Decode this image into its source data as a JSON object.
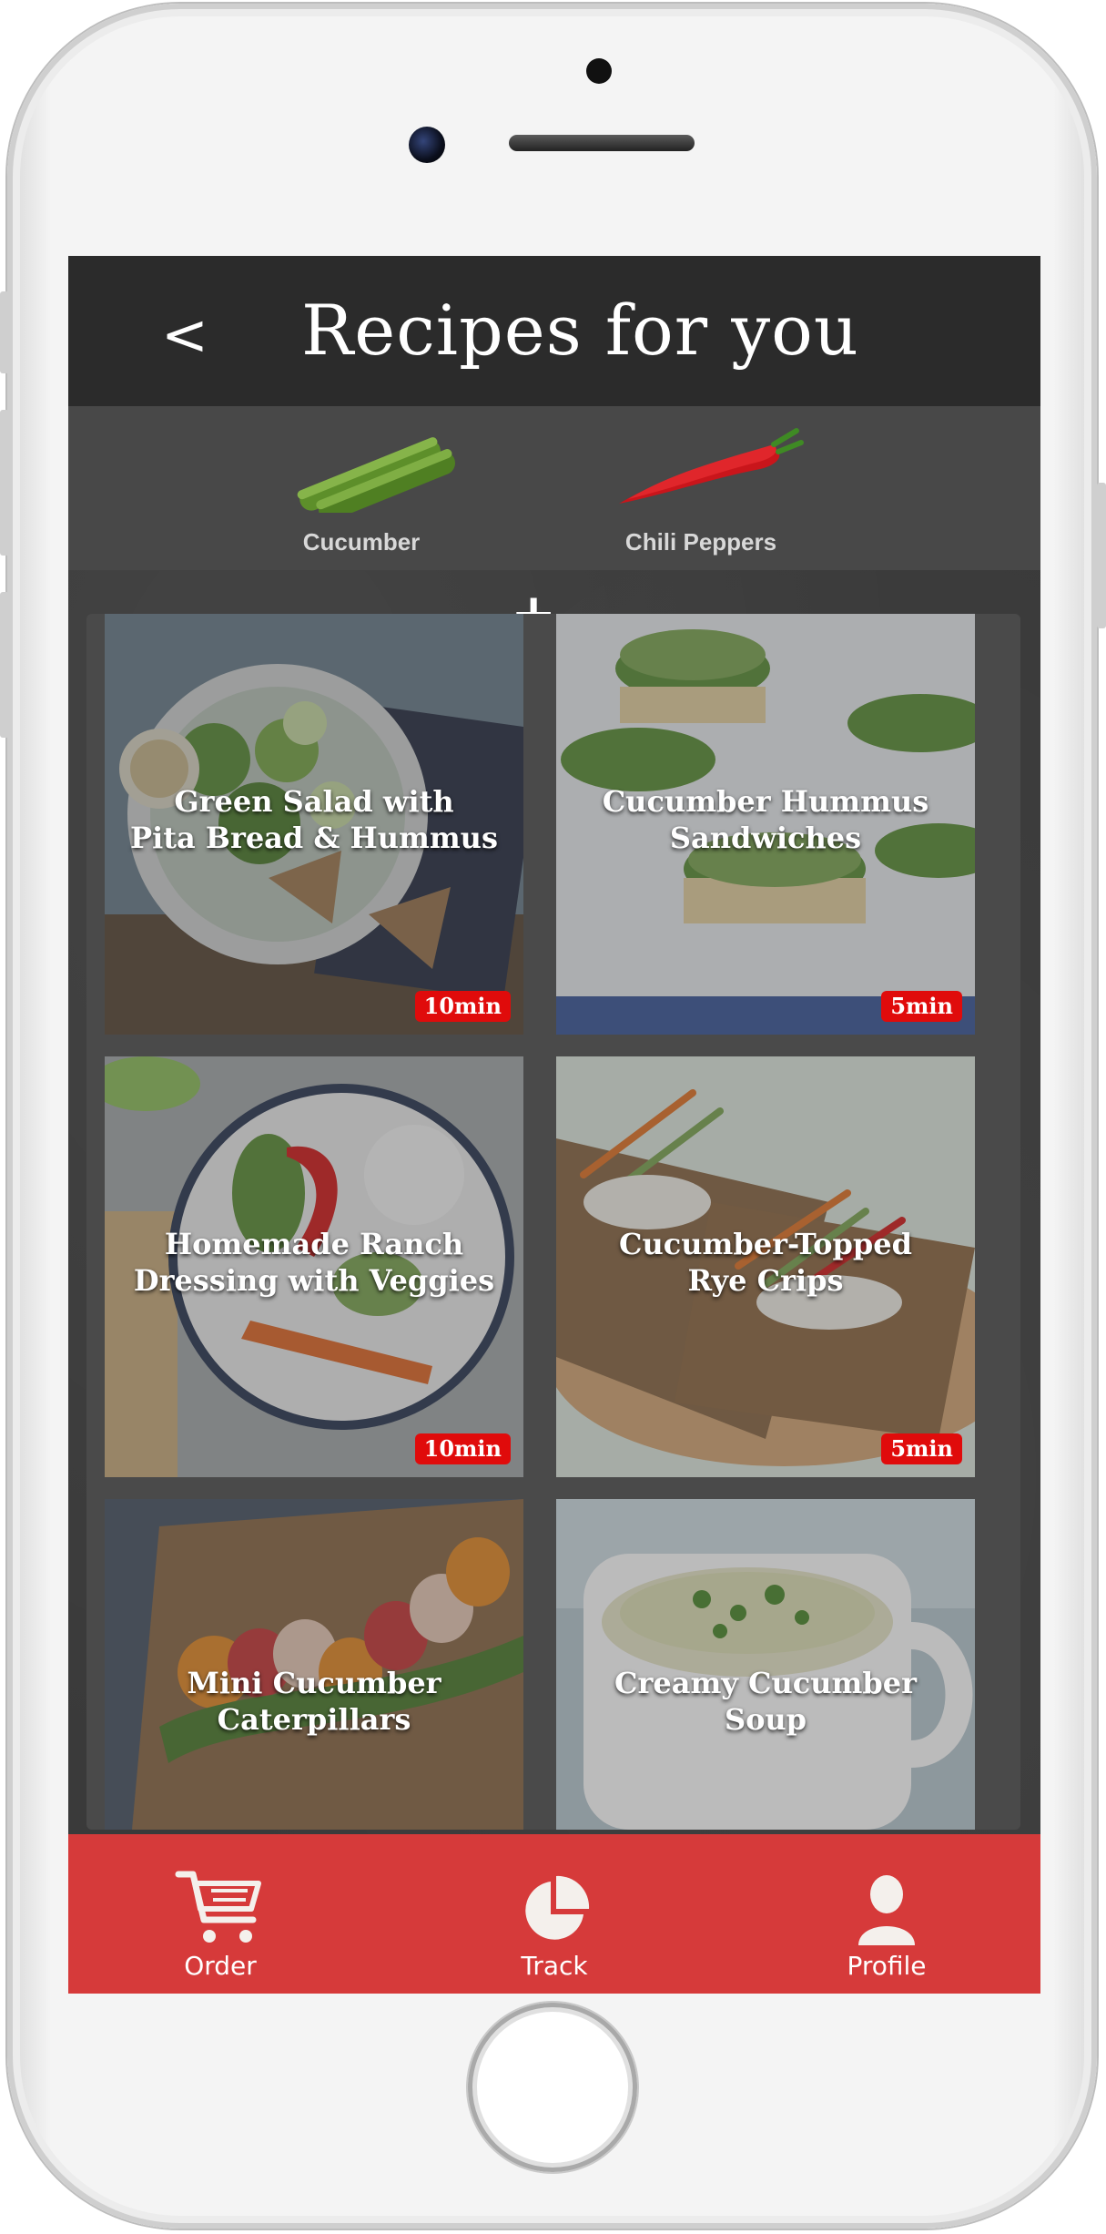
{
  "header": {
    "back_label": "<",
    "title": "Recipes for you"
  },
  "ingredients": {
    "items": [
      {
        "name": "Cucumber",
        "icon": "cucumber-icon"
      },
      {
        "name": "Chili Peppers",
        "icon": "chili-pepper-icon"
      }
    ],
    "joiner": "+"
  },
  "recipes": [
    {
      "title_line1": "Green Salad with",
      "title_line2": "Pita Bread & Hummus",
      "time": "10min"
    },
    {
      "title_line1": "Cucumber Hummus",
      "title_line2": "Sandwiches",
      "time": "5min"
    },
    {
      "title_line1": "Homemade Ranch",
      "title_line2": "Dressing with Veggies",
      "time": "10min"
    },
    {
      "title_line1": "Cucumber-Topped",
      "title_line2": "Rye Crips",
      "time": "5min"
    },
    {
      "title_line1": "Mini Cucumber",
      "title_line2": "Caterpillars",
      "time": ""
    },
    {
      "title_line1": "Creamy Cucumber",
      "title_line2": "Soup",
      "time": ""
    }
  ],
  "nav": {
    "items": [
      {
        "label": "Order",
        "icon": "cart-icon"
      },
      {
        "label": "Track",
        "icon": "pie-chart-icon"
      },
      {
        "label": "Profile",
        "icon": "user-icon"
      }
    ]
  },
  "colors": {
    "accent": "#d63a3a",
    "badge": "#e00b0b",
    "header_bg": "#2b2b2b",
    "screen_bg": "#3a3a3a"
  }
}
